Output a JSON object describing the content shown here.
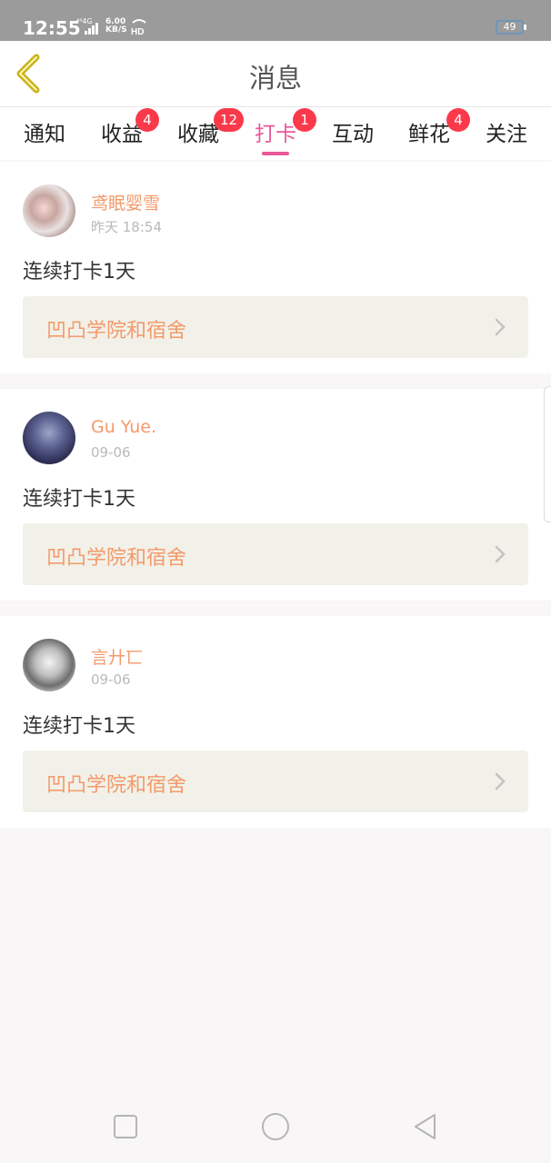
{
  "status_bar": {
    "time": "12:55",
    "network": "⁴⁶4G",
    "speed_value": "6.00",
    "speed_unit": "KB/S",
    "hd": "HD",
    "battery": "49"
  },
  "header": {
    "title": "消息",
    "back_icon": "chevron-left-icon"
  },
  "tabs": [
    {
      "label": "通知",
      "badge": ""
    },
    {
      "label": "收益",
      "badge": "4"
    },
    {
      "label": "收藏",
      "badge": "12"
    },
    {
      "label": "打卡",
      "badge": "1",
      "active": true
    },
    {
      "label": "互动",
      "badge": ""
    },
    {
      "label": "鲜花",
      "badge": "4"
    },
    {
      "label": "关注",
      "badge": ""
    }
  ],
  "feed": [
    {
      "username": "鸢眠婴雪",
      "time": "昨天 18:54",
      "content": "连续打卡1天",
      "link": "凹凸学院和宿舍"
    },
    {
      "username": "Gu Yue.",
      "time": "09-06",
      "content": "连续打卡1天",
      "link": "凹凸学院和宿舍"
    },
    {
      "username": "言廾匸",
      "time": "09-06",
      "content": "连续打卡1天",
      "link": "凹凸学院和宿舍"
    }
  ],
  "colors": {
    "accent": "#e8589a",
    "username": "#f39a6b",
    "badge": "#fa3a4b",
    "back_icon": "#c9b21f"
  },
  "navbar": [
    "square-icon",
    "circle-home-icon",
    "triangle-back-icon"
  ]
}
